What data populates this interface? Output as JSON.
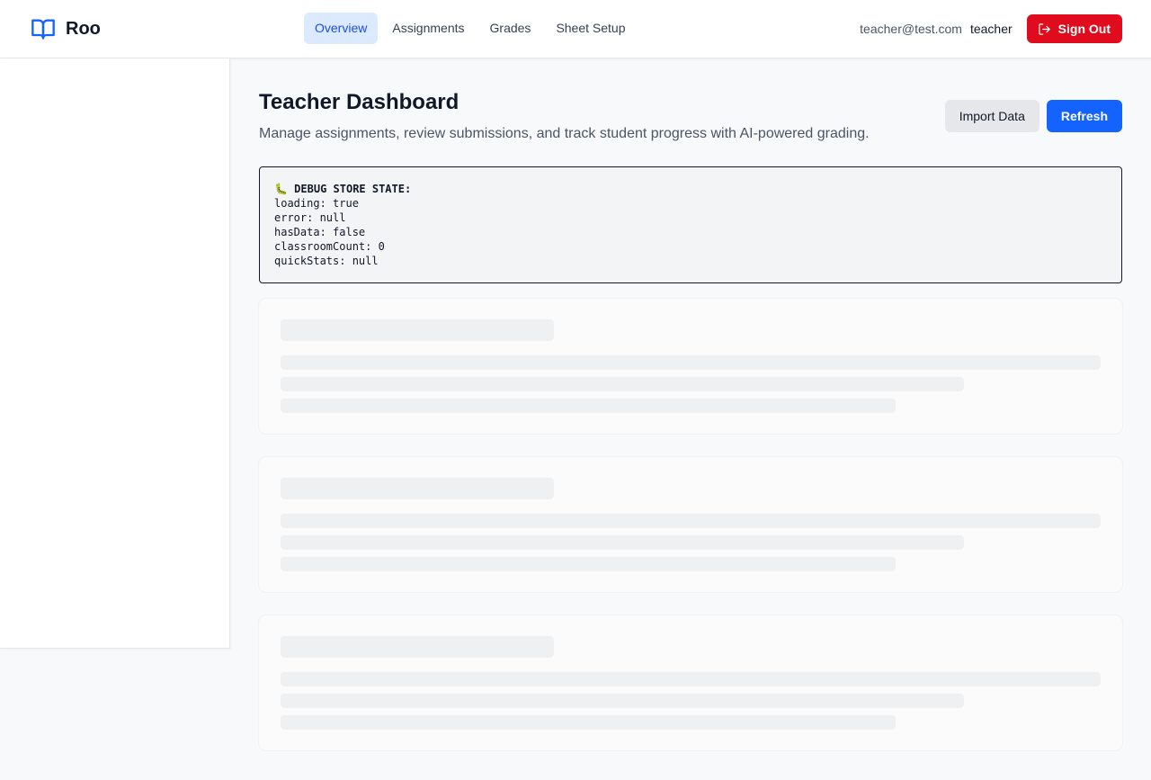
{
  "app": {
    "name": "Roo",
    "logo_icon": "book-open-icon",
    "accent": "#1463ff"
  },
  "nav": {
    "tabs": [
      {
        "label": "Overview",
        "active": true
      },
      {
        "label": "Assignments",
        "active": false
      },
      {
        "label": "Grades",
        "active": false
      },
      {
        "label": "Sheet Setup",
        "active": false
      }
    ]
  },
  "user": {
    "email": "teacher@test.com",
    "role": "teacher",
    "signout_label": "Sign Out",
    "signout_icon": "log-out-icon",
    "signout_color": "#e00b1c"
  },
  "page": {
    "title": "Teacher Dashboard",
    "subtitle": "Manage assignments, review submissions, and track student progress with AI-powered grading.",
    "import_label": "Import Data",
    "refresh_label": "Refresh"
  },
  "debug": {
    "title": "🐛 DEBUG STORE STATE:",
    "lines": [
      "loading: true",
      "error: null",
      "hasData: false",
      "classroomCount: 0",
      "quickStats: null"
    ]
  }
}
